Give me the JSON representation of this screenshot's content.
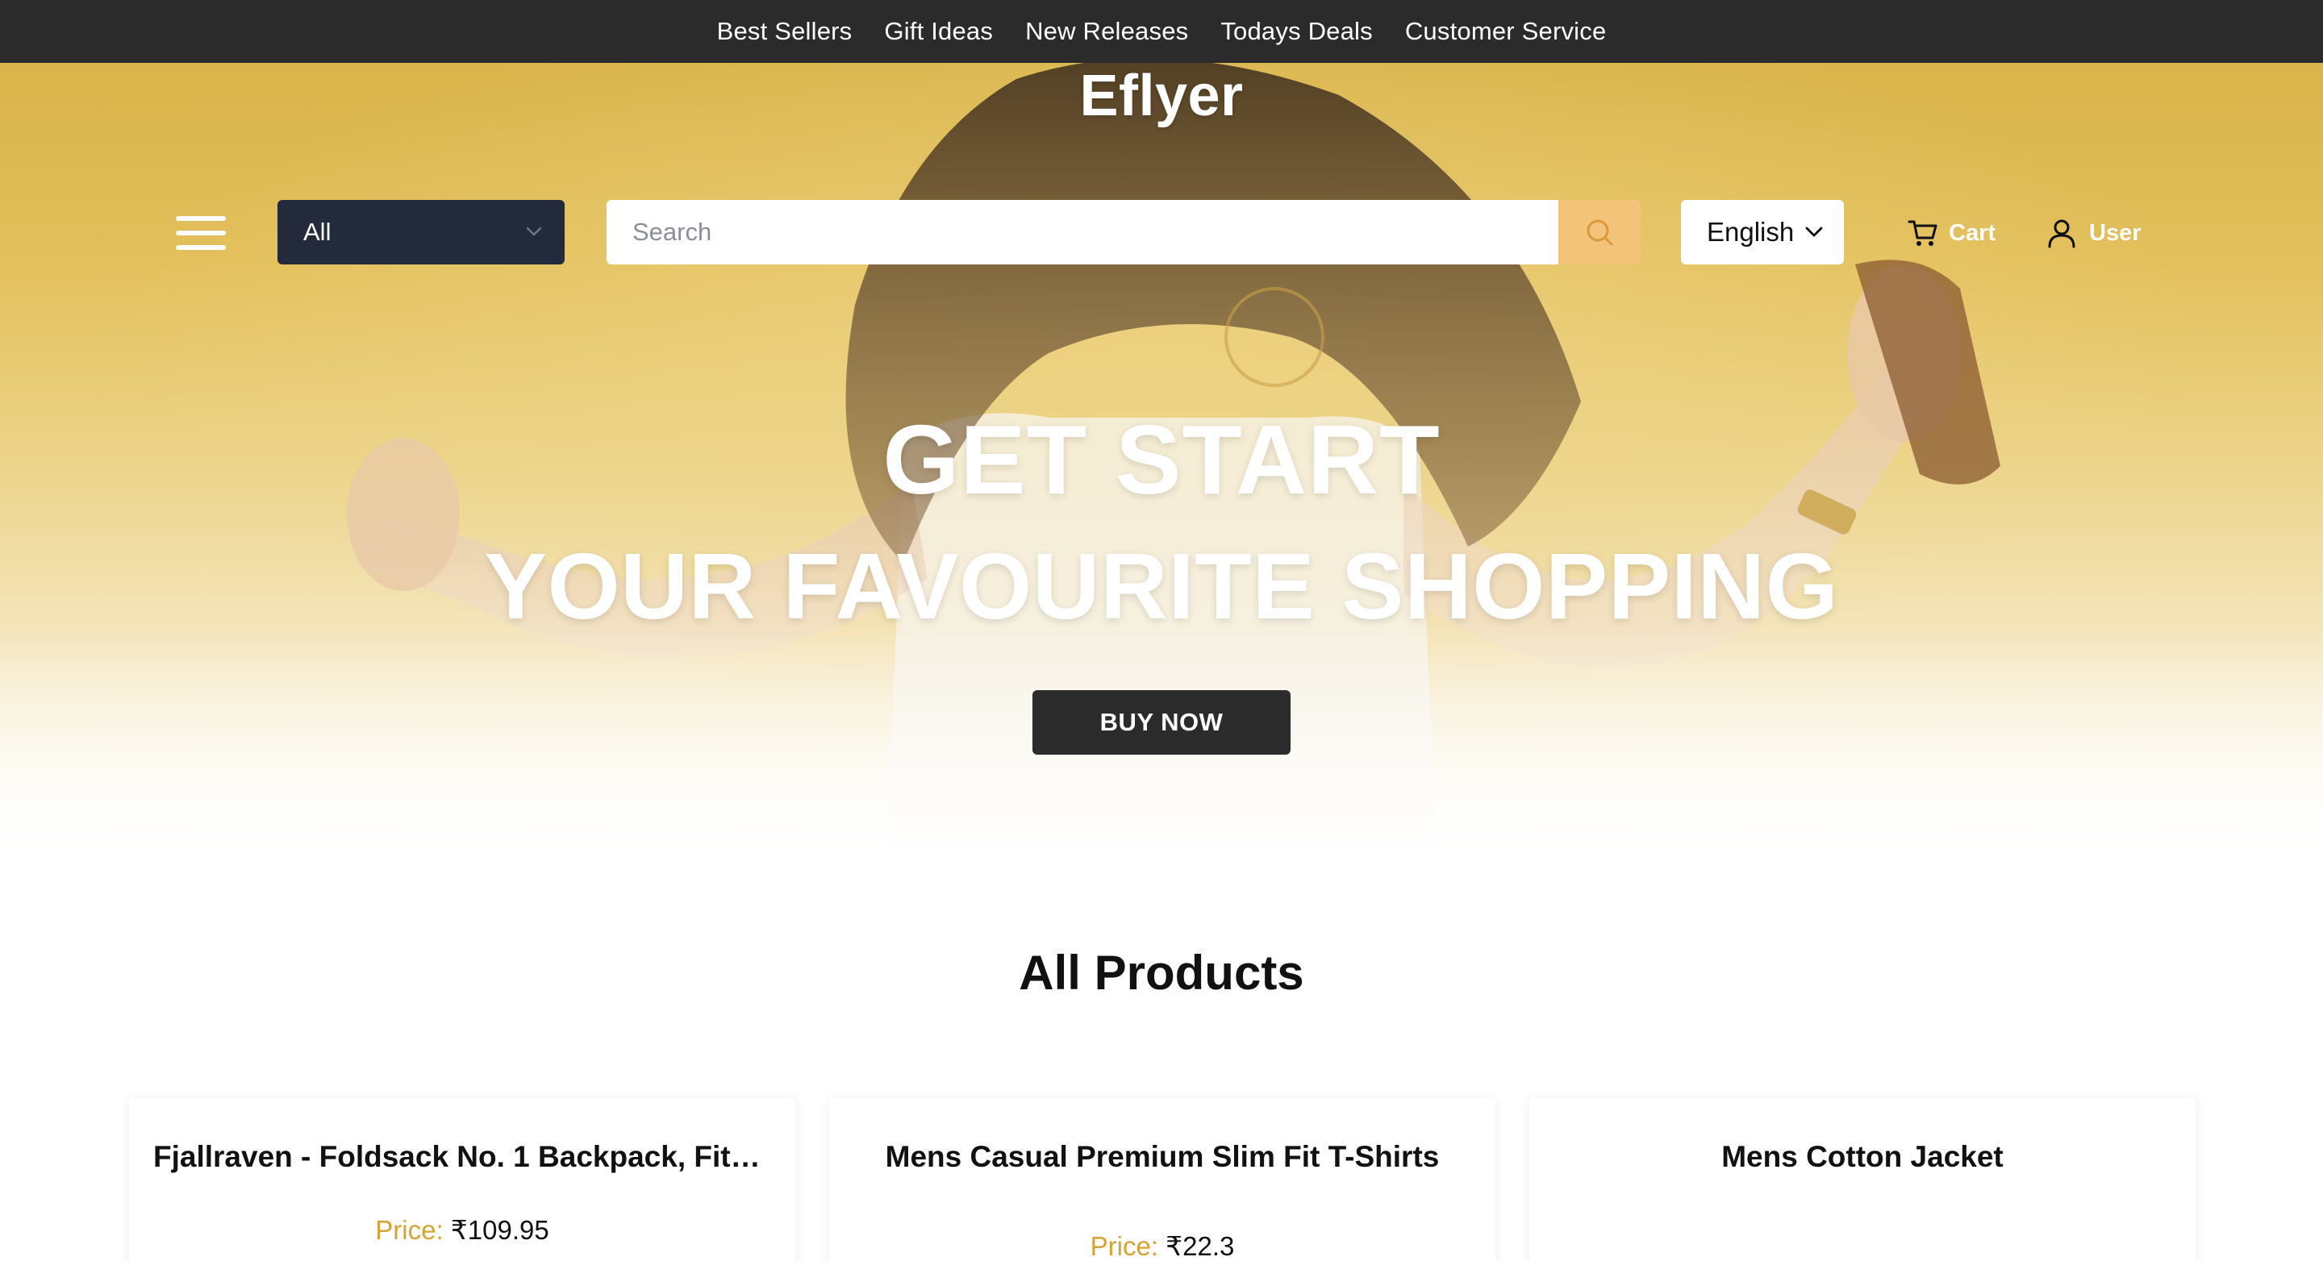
{
  "topnav": {
    "links": [
      "Best Sellers",
      "Gift Ideas",
      "New Releases",
      "Todays Deals",
      "Customer Service"
    ]
  },
  "header": {
    "brand": "Eflyer",
    "category_select": {
      "value": "All"
    },
    "search": {
      "placeholder": "Search",
      "value": ""
    },
    "language_select": {
      "value": "English"
    },
    "cart_label": "Cart",
    "user_label": "User"
  },
  "hero": {
    "headline_line1": "GET START",
    "headline_line2": "YOUR FAVOURITE SHOPPING",
    "cta_label": "BUY NOW"
  },
  "products": {
    "section_title": "All Products",
    "price_label": "Price:",
    "items": [
      {
        "title": "Fjallraven - Foldsack No. 1 Backpack, Fits...",
        "price": "₹109.95"
      },
      {
        "title": "Mens Casual Premium Slim Fit T-Shirts",
        "price": "₹22.3"
      },
      {
        "title": "Mens Cotton Jacket",
        "price": ""
      }
    ]
  },
  "icons": {
    "menu": "hamburger-menu-icon",
    "search": "search-icon",
    "chevron": "chevron-down-icon",
    "cart": "cart-icon",
    "user": "user-icon"
  },
  "colors": {
    "topbar_bg": "#2b2b2b",
    "category_bg": "#232a3b",
    "search_btn_bg": "#f4c37a",
    "price_label": "#d6a334",
    "hero_gold": "#d9b44a"
  }
}
